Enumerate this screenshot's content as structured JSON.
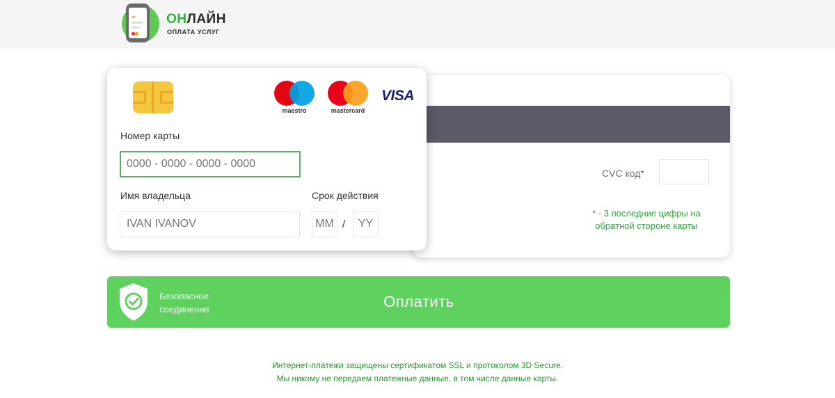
{
  "header": {
    "logo_title_accent": "ОН",
    "logo_title_rest": "ЛАЙН",
    "logo_subtitle": "ОПЛАТА УСЛУГ"
  },
  "card_front": {
    "brands": {
      "maestro": "maestro",
      "mastercard": "mastercard",
      "visa": "VISA"
    },
    "card_number_label": "Номер карты",
    "card_number_placeholder": "0000 - 0000 - 0000 - 0000",
    "card_number_value": "",
    "holder_label": "Имя владельца",
    "holder_placeholder": "IVAN IVANOV",
    "holder_value": "",
    "expiry_label": "Срок действия",
    "month_placeholder": "MM",
    "year_placeholder": "YY",
    "expiry_separator": "/"
  },
  "card_back": {
    "cvc_label": "CVC код*",
    "cvc_value": "",
    "cvc_note_line1": "* - 3 последние цифры на",
    "cvc_note_line2": "обратной стороне карты"
  },
  "pay_bar": {
    "secure_line1": "Безопасное",
    "secure_line2": "соединение",
    "pay_button": "Оплатить"
  },
  "footer": {
    "line1": "Интернет-платежи защищены сертификатом SSL и протоколом 3D Secure.",
    "line2": "Мы никому не передаем платежные данные, в том числе данные карты."
  },
  "colors": {
    "accent_green": "#5fd15f",
    "text_green": "#2ea43c",
    "stripe": "#5b5a66",
    "chip": "#f5c73f"
  }
}
